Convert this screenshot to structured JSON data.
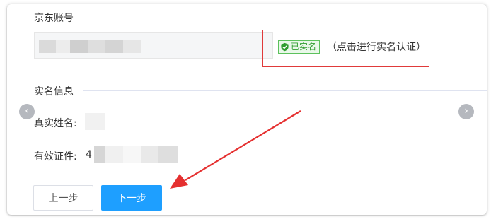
{
  "account": {
    "label": "京东账号",
    "verify_badge": "已实名",
    "verify_link": "（点击进行实名认证）"
  },
  "realname": {
    "section_title": "实名信息",
    "name_label": "真实姓名:",
    "id_label": "有效证件:",
    "id_value_prefix": "4"
  },
  "buttons": {
    "prev": "上一步",
    "next": "下一步"
  },
  "carousel": {
    "left_glyph": "‹",
    "right_glyph": "›"
  },
  "colors": {
    "next_button": "#1e9fff",
    "annotation_red": "#e53030",
    "badge_green": "#2f9d2f"
  }
}
